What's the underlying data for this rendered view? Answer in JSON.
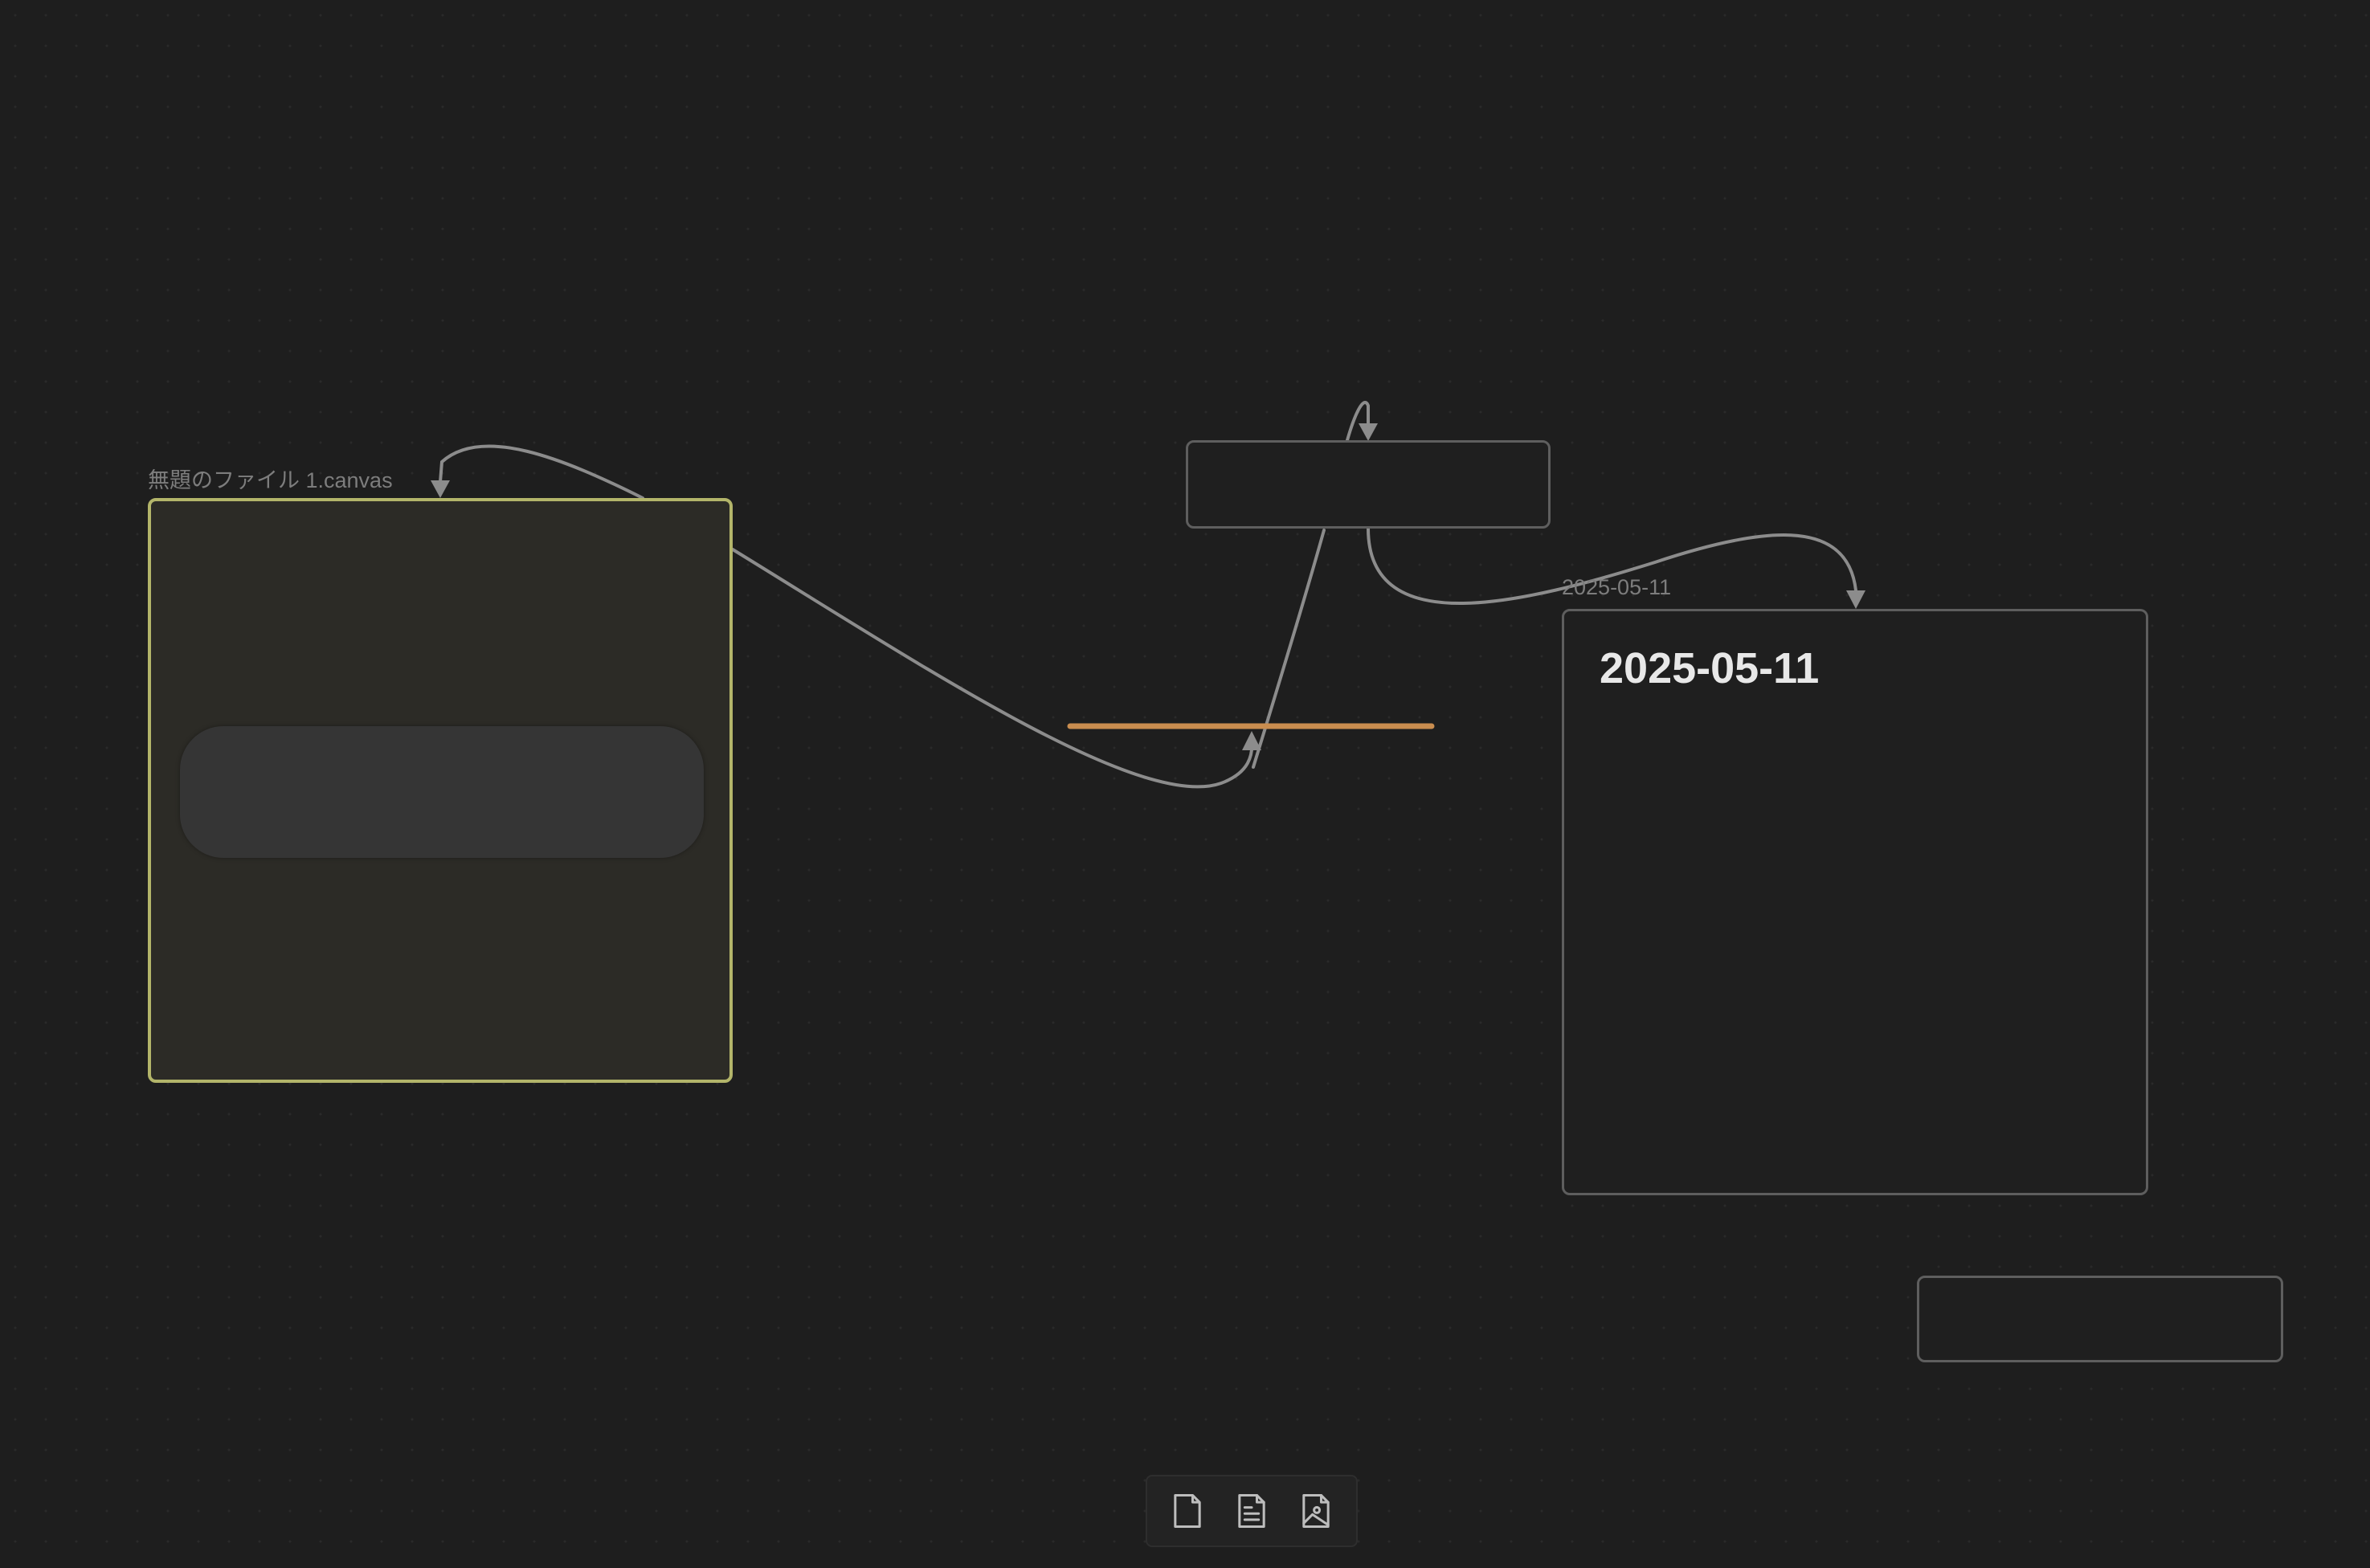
{
  "canvas": {
    "background_color": "#1e1e1e",
    "dot_color": "rgba(255,255,255,0.055)",
    "edge_color": "#8c8c8c",
    "highlight_edge_color": "#c98d4f"
  },
  "file_node": {
    "label": "無題のファイル 1.canvas",
    "border_color": "#b3b56a"
  },
  "note_node": {
    "label": "2025-05-11",
    "heading": "2025-05-11"
  },
  "toolbar": {
    "buttons": [
      {
        "name": "new-card",
        "icon": "file-icon",
        "tooltip": ""
      },
      {
        "name": "add-note",
        "icon": "file-text-icon",
        "tooltip": ""
      },
      {
        "name": "add-media",
        "icon": "file-image-icon",
        "tooltip": ""
      }
    ]
  }
}
